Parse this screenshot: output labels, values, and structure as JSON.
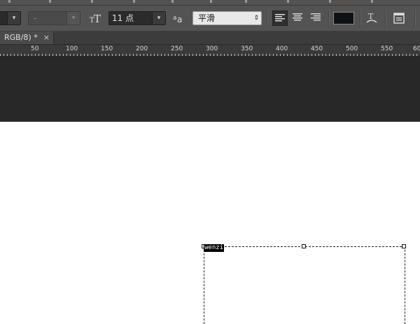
{
  "options_bar": {
    "font_style_value": "-",
    "size_icon": "text-size-icon",
    "font_size_value": "11 点",
    "antialias_icon": "antialias-icon",
    "antialias_value": "平滑",
    "align_left_icon": "align-left-icon",
    "align_center_icon": "align-center-icon",
    "align_right_icon": "align-right-icon",
    "text_color": "#0d1217",
    "warp_icon": "warp-text-icon",
    "panels_icon": "character-panel-icon"
  },
  "document": {
    "tab_label": "RGB/8) *",
    "close_glyph": "×"
  },
  "ruler": {
    "labels": [
      "50",
      "100",
      "150",
      "200",
      "250",
      "300",
      "350",
      "400",
      "450",
      "500",
      "550",
      "60"
    ]
  },
  "canvas": {
    "typed_text": "wenzi"
  }
}
